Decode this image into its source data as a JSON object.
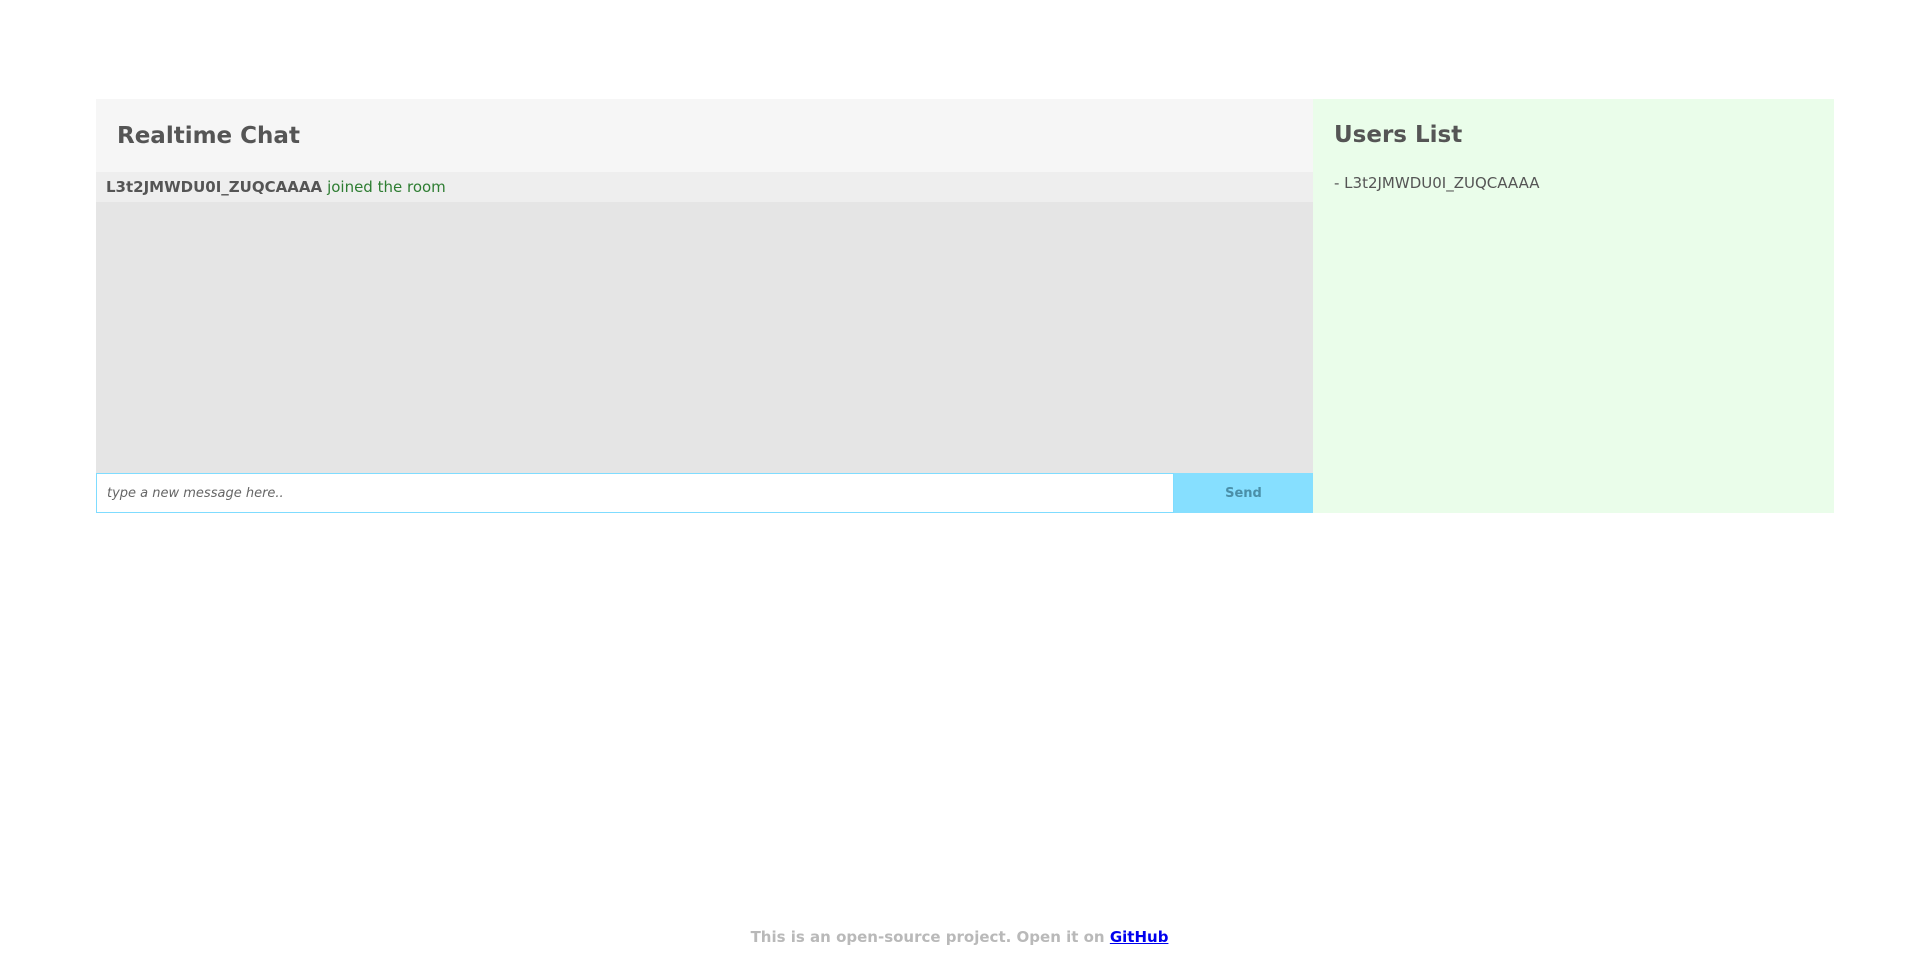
{
  "chat": {
    "title": "Realtime Chat",
    "messages": [
      {
        "user": "L3t2JMWDU0I_ZUQCAAAA",
        "text": "joined the room"
      }
    ],
    "input_placeholder": "type a new message here..",
    "send_label": "Send"
  },
  "users": {
    "title": "Users List",
    "list": [
      "- L3t2JMWDU0I_ZUQCAAAA"
    ]
  },
  "footer": {
    "text": "This is an open-source project. Open it on ",
    "link_label": "GitHub"
  },
  "colors": {
    "chat_header_bg": "#f6f6f6",
    "messages_bg": "#e5e5e5",
    "message_row_bg": "#eeeeee",
    "event_text": "#2e7d32",
    "send_button_bg": "#86dfff",
    "input_border": "#7fdcff",
    "users_panel_bg": "#eafdea",
    "footer_text": "#b9b9b9",
    "link": "#0000ee"
  }
}
